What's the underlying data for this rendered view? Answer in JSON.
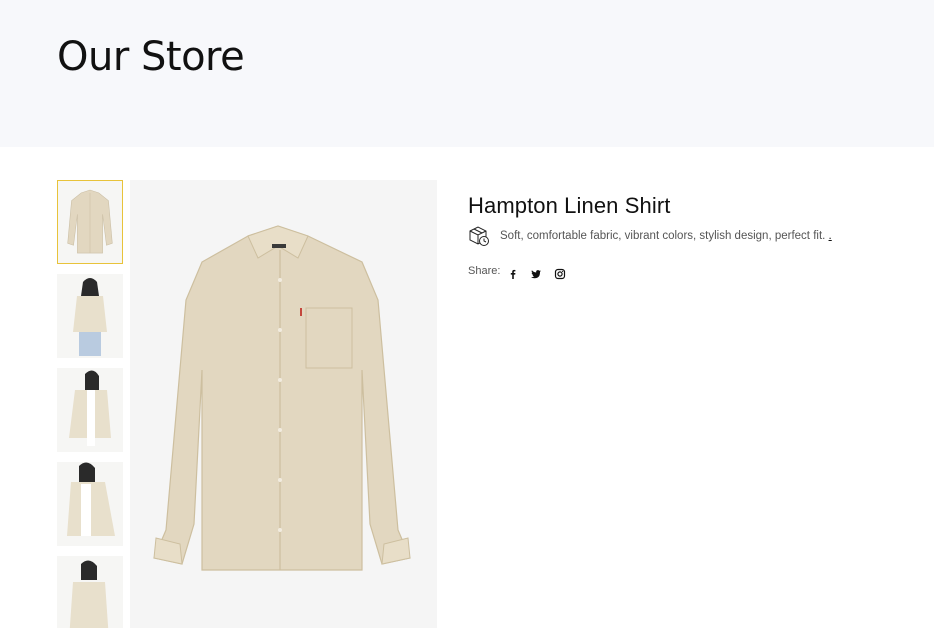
{
  "page": {
    "title": "Our Store"
  },
  "product": {
    "name": "Hampton Linen Shirt",
    "description": "Soft, comfortable fabric, vibrant colors, stylish design, perfect fit.",
    "more_link": ".",
    "share_label": "Share:",
    "share_icons": [
      "facebook-icon",
      "twitter-icon",
      "instagram-icon"
    ],
    "gallery": {
      "thumbnails": [
        "shirt-flat",
        "model-front",
        "model-open-shirt",
        "model-side",
        "model-front-2"
      ],
      "active_index": 0
    }
  },
  "colors": {
    "hero_bg": "#f7f8fb",
    "active_thumb_border": "#e8c33a",
    "shirt": "#e2d7c0"
  }
}
